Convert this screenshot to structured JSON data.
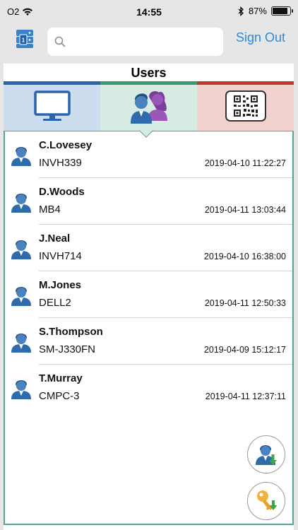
{
  "status_bar": {
    "carrier": "O2",
    "time": "14:55",
    "battery_percent": "87%",
    "battery_level": 0.87
  },
  "nav": {
    "search_placeholder": "",
    "sign_out_label": "Sign Out"
  },
  "page_title": "Users",
  "tabs": [
    {
      "id": "devices",
      "icon": "monitor-icon",
      "color": "#2a64ad"
    },
    {
      "id": "users",
      "icon": "users-icon",
      "color": "#3c9a6f",
      "selected": true
    },
    {
      "id": "qr",
      "icon": "qr-code-icon",
      "color": "#c03a2b"
    }
  ],
  "users": [
    {
      "name": "C.Lovesey",
      "device": "INVH339",
      "time": "2019-04-10 11:22:27"
    },
    {
      "name": "D.Woods",
      "device": "MB4",
      "time": "2019-04-11 13:03:44"
    },
    {
      "name": "J.Neal",
      "device": "INVH714",
      "time": "2019-04-10 16:38:00"
    },
    {
      "name": "M.Jones",
      "device": "DELL2",
      "time": "2019-04-11 12:50:33"
    },
    {
      "name": "S.Thompson",
      "device": "SM-J330FN",
      "time": "2019-04-09 15:12:17"
    },
    {
      "name": "T.Murray",
      "device": "CMPC-3",
      "time": "2019-04-11 12:37:11"
    }
  ],
  "actions": [
    {
      "icon": "user-download-icon"
    },
    {
      "icon": "key-download-icon"
    }
  ]
}
